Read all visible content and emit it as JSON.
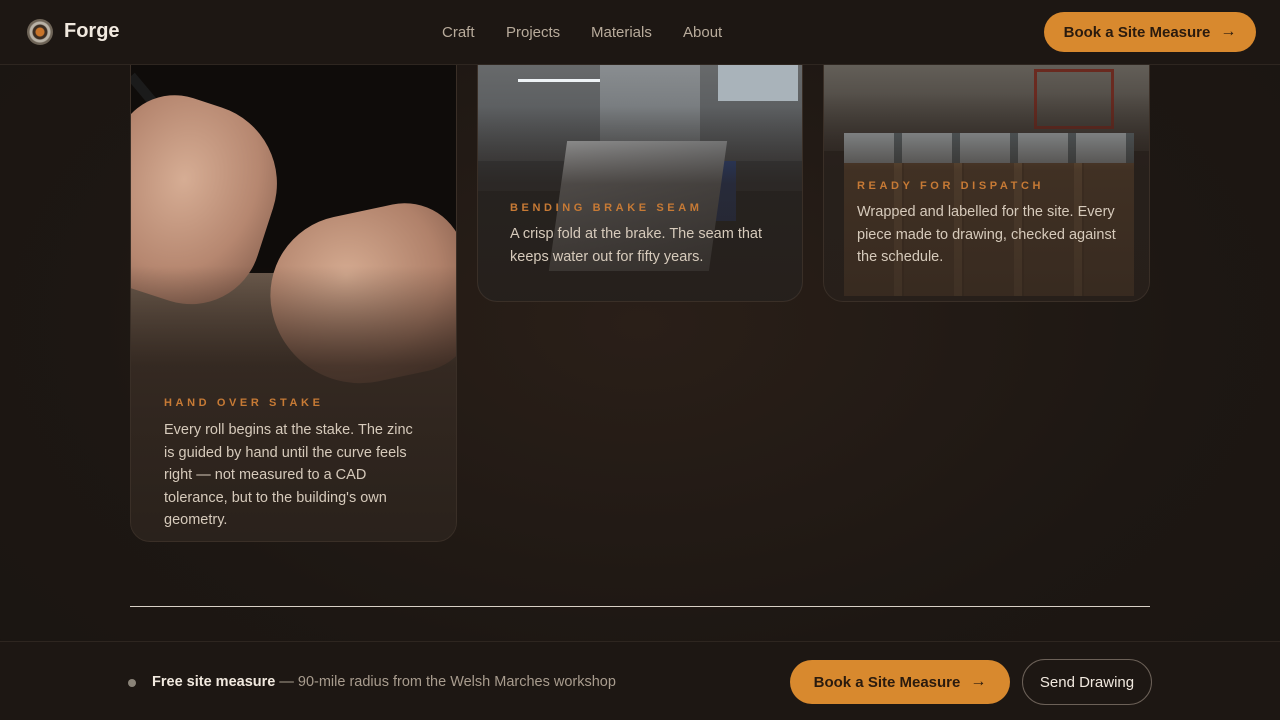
{
  "brand": {
    "name": "Forge",
    "logo_icon": "forge-logo-icon"
  },
  "nav": {
    "items": [
      "Craft",
      "Projects",
      "Materials",
      "About"
    ]
  },
  "header_cta": {
    "label": "Book a Site Measure",
    "icon": "arrow-right-icon"
  },
  "cards": [
    {
      "kicker": "HAND OVER STAKE",
      "text": "Every roll begins at the stake. The zinc is guided by hand until the curve feels right — not measured to a CAD tolerance, but to the building's own geometry."
    },
    {
      "kicker": "BENDING BRAKE SEAM",
      "text": "A crisp fold at the brake. The seam that keeps water out for fifty years."
    },
    {
      "kicker": "READY FOR DISPATCH",
      "text": "Wrapped and labelled for the site. Every piece made to drawing, checked against the schedule."
    }
  ],
  "footer": {
    "note_strong": "Free site measure",
    "note_rest": " — 90-mile radius from the Welsh Marches workshop",
    "primary_label": "Book a Site Measure",
    "secondary_label": "Send Drawing"
  },
  "colors": {
    "accent": "#d8892e",
    "background": "#1d1713",
    "kicker": "#c77a35"
  }
}
